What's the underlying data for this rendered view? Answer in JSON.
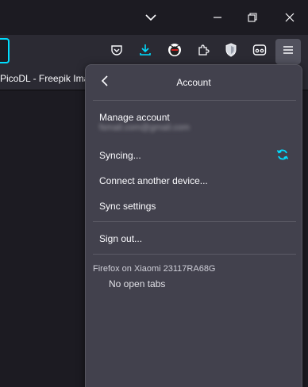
{
  "bookmarks": {
    "items": [
      {
        "label": "PicoDL - Freepik Ima"
      }
    ]
  },
  "account_panel": {
    "title": "Account",
    "manage_account": "Manage account",
    "email": "fsmail.com@gmail.com",
    "syncing": "Syncing...",
    "connect_device": "Connect another device...",
    "sync_settings": "Sync settings",
    "sign_out": "Sign out...",
    "device_name": "Firefox on Xiaomi 23117RA68G",
    "no_open_tabs": "No open tabs"
  },
  "icons": {
    "titlebar": [
      "list-all-tabs-icon",
      "minimize-icon",
      "restore-icon",
      "close-icon"
    ],
    "toolbar": [
      "pocket-icon",
      "download-icon",
      "extension-avatar-icon",
      "extensions-icon",
      "shield-extension-icon",
      "container-icon",
      "menu-icon"
    ]
  },
  "colors": {
    "accent": "#00ddff",
    "panel_bg": "#42414d",
    "toolbar_bg": "#2b2a33",
    "window_bg": "#1c1b22"
  }
}
